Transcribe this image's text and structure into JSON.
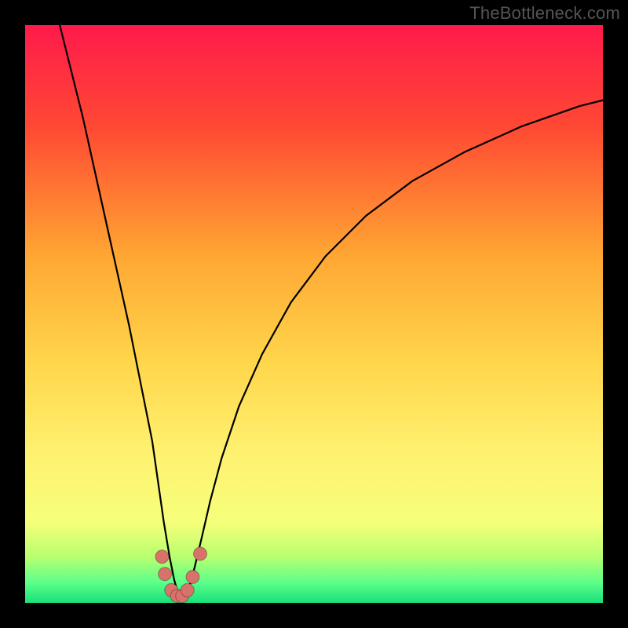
{
  "watermark": {
    "text": "TheBottleneck.com"
  },
  "chart_data": {
    "type": "line",
    "title": "",
    "xlabel": "",
    "ylabel": "",
    "xlim": [
      0,
      100
    ],
    "ylim": [
      0,
      100
    ],
    "gradient_stops": [
      {
        "offset": 0.0,
        "color": "#ff1a4b"
      },
      {
        "offset": 0.18,
        "color": "#ff4a33"
      },
      {
        "offset": 0.4,
        "color": "#ffa733"
      },
      {
        "offset": 0.58,
        "color": "#ffd54a"
      },
      {
        "offset": 0.74,
        "color": "#fff170"
      },
      {
        "offset": 0.86,
        "color": "#f6ff7a"
      },
      {
        "offset": 0.92,
        "color": "#b8ff6f"
      },
      {
        "offset": 0.965,
        "color": "#5cff8a"
      },
      {
        "offset": 1.0,
        "color": "#18e07a"
      }
    ],
    "series": [
      {
        "name": "bottleneck-curve",
        "minimum_x": 27,
        "points": [
          {
            "x": 6.0,
            "y": 100.0
          },
          {
            "x": 8.0,
            "y": 92.0
          },
          {
            "x": 10.0,
            "y": 84.0
          },
          {
            "x": 12.0,
            "y": 75.0
          },
          {
            "x": 14.0,
            "y": 66.0
          },
          {
            "x": 16.0,
            "y": 57.0
          },
          {
            "x": 18.0,
            "y": 48.0
          },
          {
            "x": 20.0,
            "y": 38.0
          },
          {
            "x": 22.0,
            "y": 28.0
          },
          {
            "x": 23.0,
            "y": 21.0
          },
          {
            "x": 24.0,
            "y": 14.0
          },
          {
            "x": 25.0,
            "y": 8.0
          },
          {
            "x": 25.8,
            "y": 4.0
          },
          {
            "x": 26.5,
            "y": 1.5
          },
          {
            "x": 27.0,
            "y": 0.8
          },
          {
            "x": 27.7,
            "y": 1.2
          },
          {
            "x": 28.5,
            "y": 3.0
          },
          {
            "x": 29.3,
            "y": 6.0
          },
          {
            "x": 30.5,
            "y": 11.0
          },
          {
            "x": 32.0,
            "y": 17.5
          },
          {
            "x": 34.0,
            "y": 25.0
          },
          {
            "x": 37.0,
            "y": 34.0
          },
          {
            "x": 41.0,
            "y": 43.0
          },
          {
            "x": 46.0,
            "y": 52.0
          },
          {
            "x": 52.0,
            "y": 60.0
          },
          {
            "x": 59.0,
            "y": 67.0
          },
          {
            "x": 67.0,
            "y": 73.0
          },
          {
            "x": 76.0,
            "y": 78.0
          },
          {
            "x": 86.0,
            "y": 82.5
          },
          {
            "x": 96.0,
            "y": 86.0
          },
          {
            "x": 100.0,
            "y": 87.0
          }
        ]
      }
    ],
    "markers": [
      {
        "x": 23.7,
        "y": 8.0,
        "r": 1.15
      },
      {
        "x": 24.2,
        "y": 5.0,
        "r": 1.15
      },
      {
        "x": 25.3,
        "y": 2.2,
        "r": 1.15
      },
      {
        "x": 26.3,
        "y": 1.2,
        "r": 1.15
      },
      {
        "x": 27.2,
        "y": 1.2,
        "r": 1.15
      },
      {
        "x": 28.1,
        "y": 2.2,
        "r": 1.15
      },
      {
        "x": 29.0,
        "y": 4.5,
        "r": 1.15
      },
      {
        "x": 30.3,
        "y": 8.5,
        "r": 1.15
      }
    ],
    "marker_style": {
      "fill": "#d9726a",
      "stroke": "rgba(0,0,0,0.35)"
    }
  }
}
